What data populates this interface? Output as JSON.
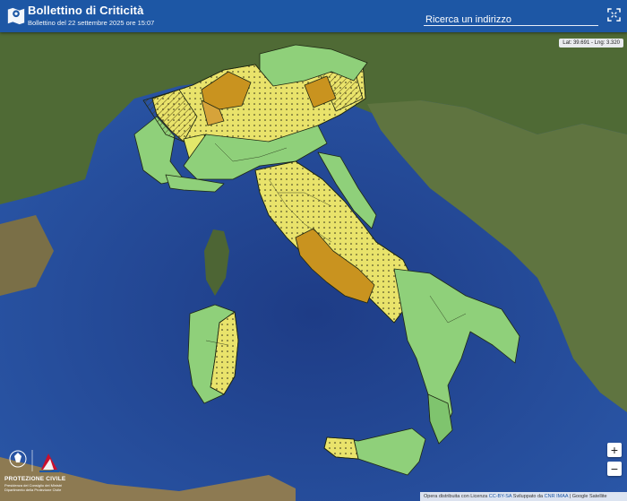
{
  "header": {
    "title": "Bollettino di Criticità",
    "subtitle": "Bollettino del 22 settembre 2025 ore 15:07",
    "search_placeholder": "Ricerca un indirizzo"
  },
  "map": {
    "coordinates": "Lat: 39.691 - Lng: 3.320",
    "zoom_in": "+",
    "zoom_out": "−",
    "legend_colors": {
      "green": "#8fd07a",
      "yellow": "#e9e36b",
      "orange": "#c9931f",
      "sea": "#1f4f9c"
    }
  },
  "logo": {
    "name": "PROTEZIONE CIVILE",
    "line1": "Presidenza del Consiglio dei Ministri",
    "line2": "Dipartimento della Protezione Civile"
  },
  "attribution": {
    "prefix": "Opera distribuita con Licenza",
    "license": "CC-BY-SA",
    "middle": "Sviluppato da",
    "dev": "CNR IMAA",
    "suffix": "| Google Satellite"
  }
}
